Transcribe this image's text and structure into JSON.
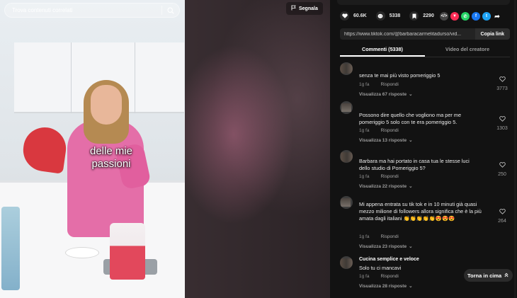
{
  "video": {
    "search_placeholder": "Trova contenuti correlati",
    "report_label": "Segnala",
    "caption_line1": "delle mie",
    "caption_line2": "passioni"
  },
  "stats": {
    "likes": "60.6K",
    "comments": "5338",
    "saves": "2290"
  },
  "share_icons": [
    "embed-icon",
    "tiktok-repost-icon",
    "whatsapp-icon",
    "facebook-icon",
    "twitter-icon",
    "share-arrow-icon"
  ],
  "share_colors": {
    "embed": "#444444",
    "repost": "#fe2c55",
    "whatsapp": "#25d366",
    "facebook": "#1877f2",
    "twitter": "#1da1f2"
  },
  "link": {
    "url": "https://www.tiktok.com/@barbaracarmelitadurso/vid...",
    "copy_label": "Copia link"
  },
  "tabs": [
    {
      "label": "Commenti (5338)",
      "active": true
    },
    {
      "label": "Video del creatore",
      "active": false
    }
  ],
  "comments": [
    {
      "text": "senza te mai più visto pomeriggio 5",
      "time": "1g fa",
      "reply": "Rispondi",
      "replies": "Visualizza 67 risposte",
      "likes": "3773"
    },
    {
      "text": "Possono dire quello che vogliono ma per me pomeriggio 5 solo con te era pomeriggio 5.",
      "time": "1g fa",
      "reply": "Rispondi",
      "replies": "Visualizza 13 risposte",
      "likes": "1303"
    },
    {
      "text": "Barbara ma hai portato in casa tua le stesse luci dello studio di Pomeriggio 5?",
      "time": "1g fa",
      "reply": "Rispondi",
      "replies": "Visualizza 22 risposte",
      "likes": "250"
    },
    {
      "text": "Mi appena entrata su tik tok e in 10 minuti già quasi mezzo milione di followers allora significa che è la più amata dagli italiani 👏👏👏👏👏😍😍😍",
      "time": "1g fa",
      "reply": "Rispondi",
      "replies": "Visualizza 23 risposte",
      "likes": "264"
    },
    {
      "author": "Cucina semplice e veloce",
      "text": "Solo tu ci mancavi",
      "time": "1g fa",
      "reply": "Rispondi",
      "replies": "Visualizza 28 risposte",
      "likes": ""
    }
  ],
  "back_to_top": "Torna in cima"
}
